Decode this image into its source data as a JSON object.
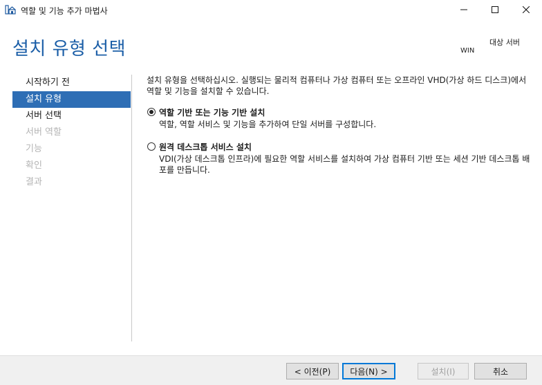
{
  "window": {
    "title": "역할 및 기능 추가 마법사",
    "icon": "server-manager-icon"
  },
  "header": {
    "page_title": "설치 유형 선택",
    "target_label": "대상 서버",
    "target_value": "WIN"
  },
  "nav": {
    "items": [
      {
        "label": "시작하기 전",
        "state": "normal"
      },
      {
        "label": "설치 유형",
        "state": "active"
      },
      {
        "label": "서버 선택",
        "state": "normal"
      },
      {
        "label": "서버 역할",
        "state": "disabled"
      },
      {
        "label": "기능",
        "state": "disabled"
      },
      {
        "label": "확인",
        "state": "disabled"
      },
      {
        "label": "결과",
        "state": "disabled"
      }
    ]
  },
  "content": {
    "intro": "설치 유형을 선택하십시오. 실행되는 물리적 컴퓨터나 가상 컴퓨터 또는 오프라인 VHD(가상 하드 디스크)에서 역할 및 기능을 설치할 수 있습니다.",
    "options": [
      {
        "label": "역할 기반 또는 기능 기반 설치",
        "description": "역할, 역할 서비스 및 기능을 추가하여 단일 서버를 구성합니다.",
        "selected": true
      },
      {
        "label": "원격 데스크톱 서비스 설치",
        "description": "VDI(가상 데스크톱 인프라)에 필요한 역할 서비스를 설치하여 가상 컴퓨터 기반 또는 세션 기반 데스크톱 배포를 만듭니다.",
        "selected": false
      }
    ]
  },
  "footer": {
    "prev": "< 이전(P)",
    "next": "다음(N) >",
    "install": "설치(I)",
    "cancel": "취소"
  },
  "colors": {
    "title_blue": "#1b5ea7",
    "nav_active": "#2e6eb5",
    "footer_bg": "#f0f0f0"
  }
}
